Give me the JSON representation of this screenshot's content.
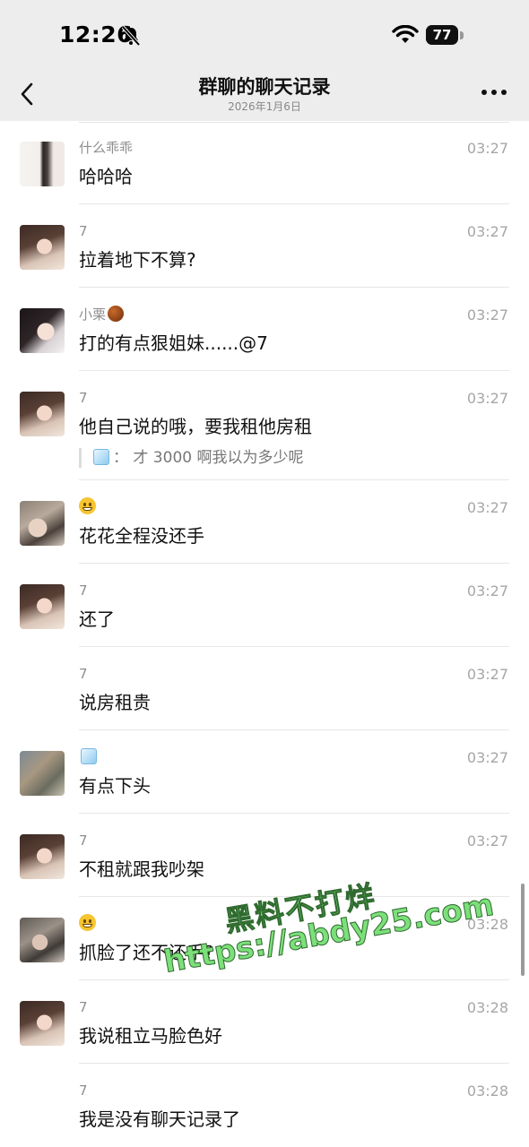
{
  "status_bar": {
    "time": "12:26",
    "battery": "77",
    "battery_level": 0.77
  },
  "header": {
    "title": "群聊的聊天记录",
    "date": "2026年1月6日"
  },
  "messages": [
    {
      "sender": "什么乖乖",
      "time": "03:27",
      "text": "哈哈哈"
    },
    {
      "sender": "7",
      "time": "03:27",
      "text": "拉着地下不算?"
    },
    {
      "sender": "小栗",
      "time": "03:27",
      "text": "打的有点狠姐妹......@7"
    },
    {
      "sender": "7",
      "time": "03:27",
      "text": "他自己说的哦，要我租他房租",
      "quote": "： 才 3000 啊我以为多少呢"
    },
    {
      "sender": "",
      "time": "03:27",
      "text": "花花全程没还手"
    },
    {
      "sender": "7",
      "time": "03:27",
      "text": "还了"
    },
    {
      "sender": "7",
      "time": "03:27",
      "text": "说房租贵"
    },
    {
      "sender": "",
      "time": "03:27",
      "text": "有点下头"
    },
    {
      "sender": "7",
      "time": "03:27",
      "text": "不租就跟我吵架"
    },
    {
      "sender": "",
      "time": "03:28",
      "text": "抓脸了还不还手?"
    },
    {
      "sender": "7",
      "time": "03:28",
      "text": "我说租立马脸色好"
    },
    {
      "sender": "7",
      "time": "03:28",
      "text": "我是没有聊天记录了"
    }
  ],
  "watermark": {
    "line1": "黑料不打烊",
    "line2": "https://abdy25.com"
  },
  "colors": {
    "accent_watermark": "#7ce07a",
    "header_bg": "#ededed",
    "divider": "#e6e6e6"
  }
}
